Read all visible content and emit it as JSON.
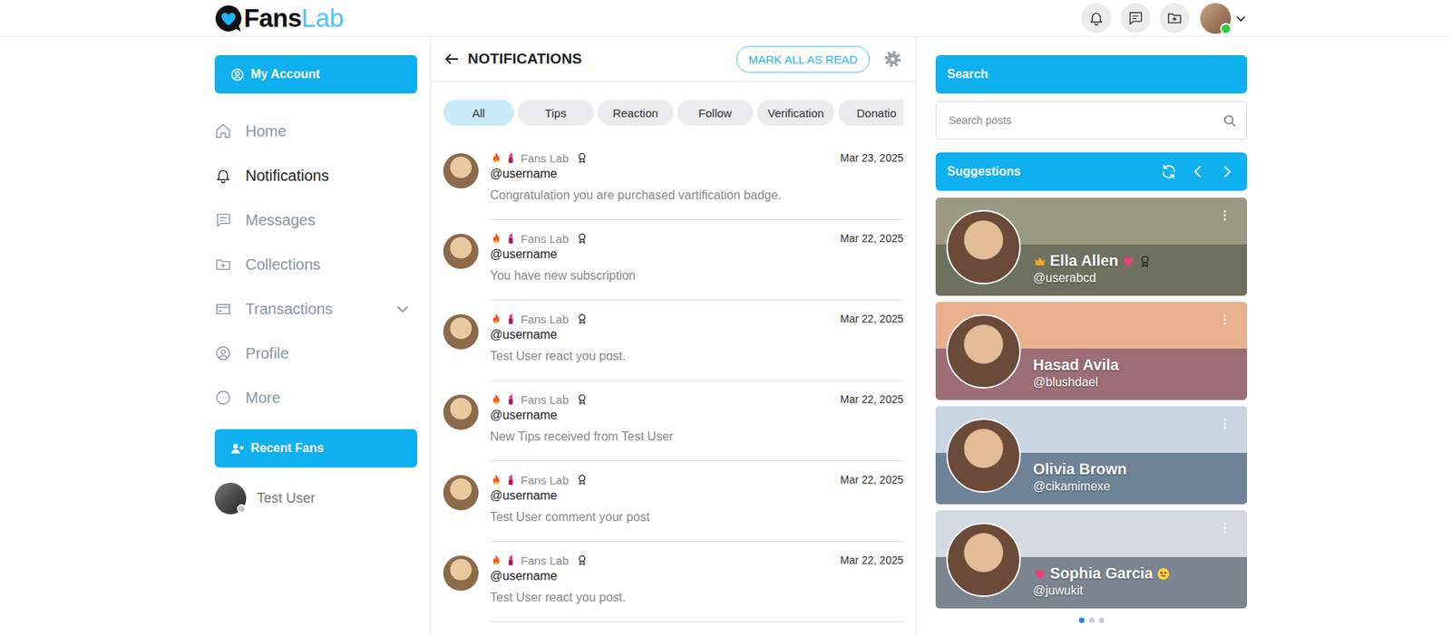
{
  "topbar": {
    "logo": {
      "first": "Fans",
      "second": "Lab"
    },
    "user": {
      "online": true
    }
  },
  "sidebar": {
    "account_button": "My Account",
    "items": [
      {
        "label": "Home",
        "selected": false,
        "expandable": false,
        "expanded": false
      },
      {
        "label": "Notifications",
        "selected": true,
        "expandable": false,
        "expanded": false
      },
      {
        "label": "Messages",
        "selected": false,
        "expandable": false,
        "expanded": false
      },
      {
        "label": "Collections",
        "selected": false,
        "expandable": false,
        "expanded": false
      },
      {
        "label": "Transactions",
        "selected": false,
        "expandable": true,
        "expanded": false
      },
      {
        "label": "Profile",
        "selected": false,
        "expandable": false,
        "expanded": false
      },
      {
        "label": "More",
        "selected": false,
        "expandable": false,
        "expanded": false
      }
    ],
    "recent_fans": {
      "title": "Recent Fans",
      "fans": [
        {
          "name": "Test User",
          "online": false
        }
      ]
    }
  },
  "notifications": {
    "title": "NOTIFICATIONS",
    "mark_all": "MARK ALL AS READ",
    "filters": [
      {
        "label": "All",
        "selected": true
      },
      {
        "label": "Tips",
        "selected": false
      },
      {
        "label": "Reaction",
        "selected": false
      },
      {
        "label": "Follow",
        "selected": false
      },
      {
        "label": "Verification",
        "selected": false
      },
      {
        "label": "Donatio",
        "selected": false
      }
    ],
    "items": [
      {
        "name": "Fans Lab",
        "handle": "@username",
        "message": "Congratulation you are purchased vartification badge.",
        "date": "Mar 23, 2025"
      },
      {
        "name": "Fans Lab",
        "handle": "@username",
        "message": "You have new subscription",
        "date": "Mar 22, 2025"
      },
      {
        "name": "Fans Lab",
        "handle": "@username",
        "message": "Test User react you post.",
        "date": "Mar 22, 2025"
      },
      {
        "name": "Fans Lab",
        "handle": "@username",
        "message": "New Tips received from Test User",
        "date": "Mar 22, 2025"
      },
      {
        "name": "Fans Lab",
        "handle": "@username",
        "message": "Test User comment your post",
        "date": "Mar 22, 2025"
      },
      {
        "name": "Fans Lab",
        "handle": "@username",
        "message": "Test User react you post.",
        "date": "Mar 22, 2025"
      }
    ]
  },
  "search": {
    "title": "Search",
    "placeholder": "Search posts"
  },
  "suggestions": {
    "title": "Suggestions",
    "cards": [
      {
        "name": "Ella Allen",
        "handle": "@userabcd",
        "badges_before": [
          {
            "kind": "crown"
          }
        ],
        "badges_after": [
          {
            "kind": "heart"
          },
          {
            "kind": "award"
          }
        ]
      },
      {
        "name": "Hasad Avila",
        "handle": "@blushdael",
        "badges_before": [],
        "badges_after": []
      },
      {
        "name": "Olivia Brown",
        "handle": "@cikamimexe",
        "badges_before": [],
        "badges_after": []
      },
      {
        "name": "Sophia Garcia",
        "handle": "@juwukit",
        "badges_before": [
          {
            "kind": "heart"
          }
        ],
        "badges_after": [
          {
            "kind": "star-eyes"
          }
        ]
      }
    ],
    "pages": [
      {
        "selected": true
      },
      {
        "selected": false
      },
      {
        "selected": false
      }
    ]
  }
}
